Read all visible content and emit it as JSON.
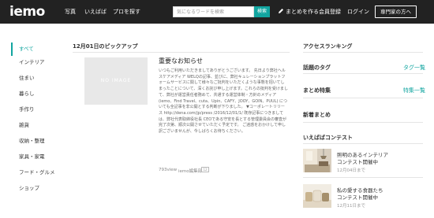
{
  "header": {
    "logo": "iemo",
    "nav": [
      "写真",
      "いえばば",
      "プロを探す"
    ],
    "search_placeholder": "気になるワードを検索",
    "search_button": "検索",
    "right_nav": [
      "まとめを作る",
      "会員登録",
      "ログイン"
    ],
    "expert_button": "専門家の方へ"
  },
  "sidebar": {
    "items": [
      "すべて",
      "インテリア",
      "住まい",
      "暮らし",
      "手作り",
      "雑貨",
      "収納・整理",
      "家具・家電",
      "フード・グルメ",
      "ショップ"
    ],
    "active_index": 0
  },
  "main": {
    "pickup_title": "12月01日のピックアップ",
    "thumb_label": "NO IMAGE",
    "article_title": "重要なお知らせ",
    "article_body": "いつもご利用いただきましてありがとうございます。 先日より弊社ヘルスケアメディア WELQの記事、並びに、弊社キュレーションプラットフォームサービスに関して様々なご批判をいただくような事態を招いてしまったことについて、深くお詫び申し上げます。これらの批判を受けまして、弊社が運営責任者務めて、共通する運営体制・方針のメディア (iemo、Find Travel、cuta、Upin、CAFY、JOOY、GOIN、PUUL) についても全記事を非公開とする判断が下りました。 ▼コーポレートリリース http://dena.com/jp/press /2016/12/01/1/ 既存記事につきましては、弊社代表取締役社長 CEOである守安を長とする管理委員会の審査が完了次第、順次公開させていただく予定です。 ご迷惑をおかけして申し訳ございませんが、今しばらくお待ちください。",
    "views": "793view",
    "author": "iemo編集部",
    "badge": "12"
  },
  "right": {
    "ranking_title": "アクセスランキング",
    "tag_title": "話題のタグ",
    "tag_link": "タグ一覧",
    "special_title": "まとめ特集",
    "special_link": "特集一覧",
    "new_title": "新着まとめ",
    "contest_title": "いえばばコンテスト",
    "contests": [
      {
        "line1": "照明のあるインテリア",
        "line2": "コンテスト開催中",
        "date": "12月04日まで"
      },
      {
        "line1": "私の愛する食器たち",
        "line2": "コンテスト開催中",
        "date": "12月11日まで"
      }
    ]
  }
}
